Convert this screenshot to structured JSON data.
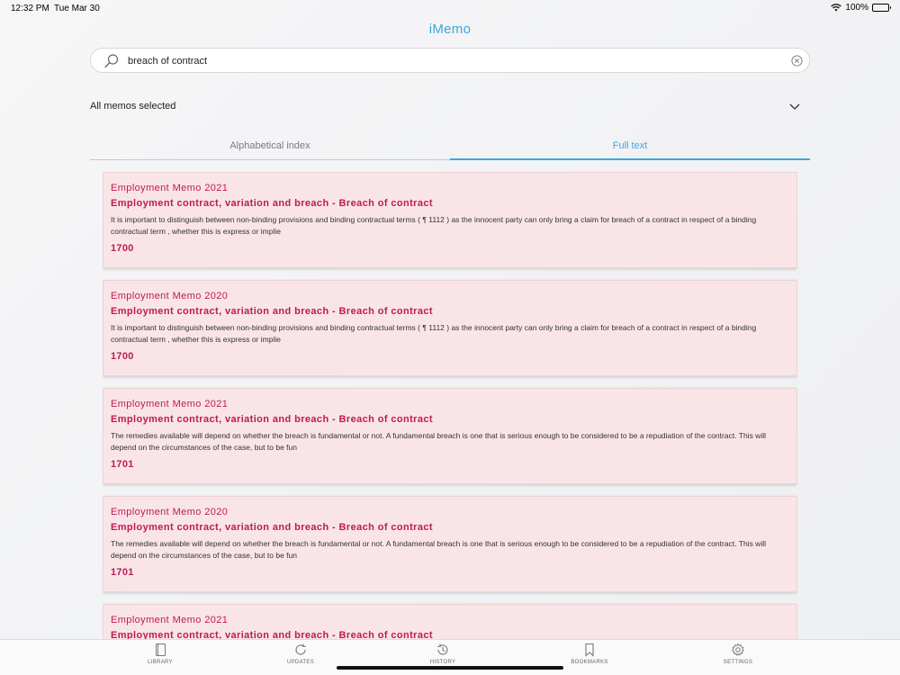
{
  "status_bar": {
    "time": "12:32 PM",
    "date": "Tue Mar 30",
    "battery": "100%"
  },
  "app": {
    "title": "iMemo"
  },
  "search": {
    "query": "breach of contract",
    "icon": "search-icon",
    "clear_icon": "clear-icon"
  },
  "memo_selector": {
    "label": "All memos selected",
    "icon": "chevron-down-icon"
  },
  "tabs": [
    {
      "label": "Alphabetical index",
      "active": false
    },
    {
      "label": "Full text",
      "active": true
    }
  ],
  "results": [
    {
      "memo": "Employment Memo 2021",
      "heading": "Employment contract, variation and breach - Breach of contract",
      "text": "It is important to distinguish between non-binding provisions and binding contractual terms ( ¶ 1112 ) as the innocent party can only bring a claim for breach of a contract in respect of a binding contractual term , whether this is express or implie",
      "paragraph": "1700"
    },
    {
      "memo": "Employment Memo 2020",
      "heading": "Employment contract, variation and breach - Breach of contract",
      "text": "It is important to distinguish between non-binding provisions and binding contractual terms ( ¶ 1112 ) as the innocent party can only bring a claim for breach of a contract in respect of a binding contractual term , whether this is express or implie",
      "paragraph": "1700"
    },
    {
      "memo": "Employment Memo 2021",
      "heading": "Employment contract, variation and breach - Breach of contract",
      "text": "The remedies available will depend on whether the breach is fundamental or not. A fundamental breach is one that is serious enough to be considered to be a repudiation of the contract. This will depend on the circumstances of the case, but to be fun",
      "paragraph": "1701"
    },
    {
      "memo": "Employment Memo 2020",
      "heading": "Employment contract, variation and breach - Breach of contract",
      "text": "The remedies available will depend on whether the breach is fundamental or not. A fundamental breach is one that is serious enough to be considered to be a repudiation of the contract. This will depend on the circumstances of the case, but to be fun",
      "paragraph": "1701"
    },
    {
      "memo": "Employment Memo 2021",
      "heading": "Employment contract, variation and breach - Breach of contract",
      "text": "",
      "paragraph": ""
    }
  ],
  "tab_bar": [
    {
      "label": "LIBRARY",
      "icon": "library-icon"
    },
    {
      "label": "UPDATES",
      "icon": "updates-icon"
    },
    {
      "label": "HISTORY",
      "icon": "history-icon"
    },
    {
      "label": "BOOKMARKS",
      "icon": "bookmarks-icon"
    },
    {
      "label": "SETTINGS",
      "icon": "settings-icon"
    }
  ],
  "colors": {
    "accent": "#3aa7de",
    "result_text": "#c0185a",
    "card_bg": "#f9e5e7"
  }
}
